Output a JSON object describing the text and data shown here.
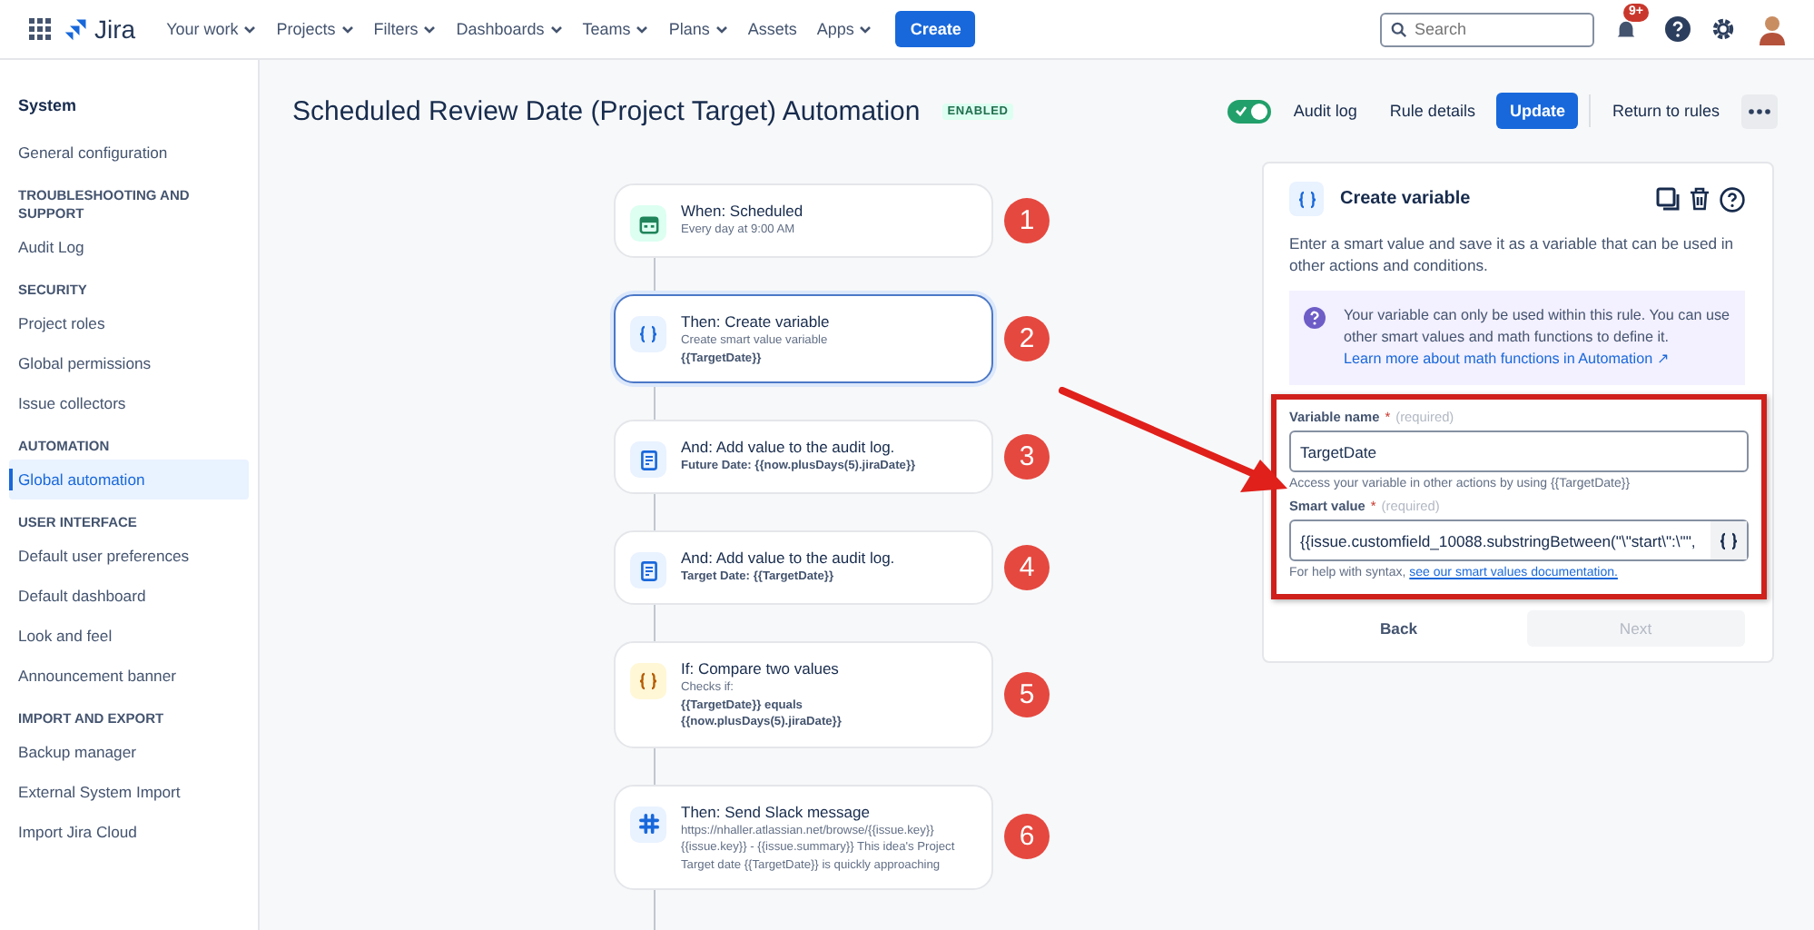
{
  "nav": {
    "product": "Jira",
    "items": [
      {
        "label": "Your work",
        "dropdown": true
      },
      {
        "label": "Projects",
        "dropdown": true
      },
      {
        "label": "Filters",
        "dropdown": true
      },
      {
        "label": "Dashboards",
        "dropdown": true
      },
      {
        "label": "Teams",
        "dropdown": true
      },
      {
        "label": "Plans",
        "dropdown": true
      },
      {
        "label": "Assets",
        "dropdown": false
      },
      {
        "label": "Apps",
        "dropdown": true
      }
    ],
    "create": "Create",
    "search": {
      "placeholder": "Search"
    },
    "notifications": "9+"
  },
  "sidebar": {
    "title": "System",
    "sections": [
      {
        "items": [
          {
            "label": "General configuration",
            "selected": false
          }
        ]
      },
      {
        "heading": "TROUBLESHOOTING AND SUPPORT",
        "items": [
          {
            "label": "Audit Log",
            "selected": false
          }
        ]
      },
      {
        "heading": "SECURITY",
        "items": [
          {
            "label": "Project roles",
            "selected": false
          },
          {
            "label": "Global permissions",
            "selected": false
          },
          {
            "label": "Issue collectors",
            "selected": false
          }
        ]
      },
      {
        "heading": "AUTOMATION",
        "items": [
          {
            "label": "Global automation",
            "selected": true
          }
        ]
      },
      {
        "heading": "USER INTERFACE",
        "items": [
          {
            "label": "Default user preferences",
            "selected": false
          },
          {
            "label": "Default dashboard",
            "selected": false
          },
          {
            "label": "Look and feel",
            "selected": false
          },
          {
            "label": "Announcement banner",
            "selected": false
          }
        ]
      },
      {
        "heading": "IMPORT AND EXPORT",
        "items": [
          {
            "label": "Backup manager",
            "selected": false
          },
          {
            "label": "External System Import",
            "selected": false
          },
          {
            "label": "Import Jira Cloud",
            "selected": false
          }
        ]
      }
    ]
  },
  "header": {
    "title": "Scheduled Review Date (Project Target) Automation",
    "status": "ENABLED",
    "toggle": {
      "on": true
    },
    "links": [
      "Audit log",
      "Rule details"
    ],
    "primary": "Update",
    "secondary": "Return to rules"
  },
  "steps": [
    {
      "kind": "calendar",
      "title": "When: Scheduled",
      "details": [
        {
          "text": "Every day at 9:00 AM",
          "bold": false
        }
      ],
      "selected": false,
      "marker": "1"
    },
    {
      "kind": "variable",
      "title": "Then: Create variable",
      "details": [
        {
          "text": "Create smart value variable",
          "bold": false
        },
        {
          "text": "{{TargetDate}}",
          "bold": true
        }
      ],
      "selected": true,
      "marker": "2"
    },
    {
      "kind": "log",
      "title": "And: Add value to the audit log.",
      "details": [
        {
          "text": "Future Date: {{now.plusDays(5).jiraDate}}",
          "bold": true
        }
      ],
      "selected": false,
      "marker": "3"
    },
    {
      "kind": "log",
      "title": "And: Add value to the audit log.",
      "details": [
        {
          "text": "Target Date: {{TargetDate}}",
          "bold": true
        }
      ],
      "selected": false,
      "marker": "4"
    },
    {
      "kind": "condition",
      "title": "If: Compare two values",
      "details": [
        {
          "text": "Checks if:",
          "bold": false
        },
        {
          "text": "{{TargetDate}} equals",
          "bold": true
        },
        {
          "text": "{{now.plusDays(5).jiraDate}}",
          "bold": true
        }
      ],
      "selected": false,
      "marker": "5"
    },
    {
      "kind": "message",
      "title": "Then: Send Slack message",
      "details": [
        {
          "text": "https://nhaller.atlassian.net/browse/{{issue.key}}",
          "bold": false
        },
        {
          "text": "{{issue.key}} - {{issue.summary}} This idea's Project Target date {{TargetDate}} is quickly approaching",
          "bold": false
        }
      ],
      "selected": false,
      "marker": "6"
    }
  ],
  "panel": {
    "title": "Create variable",
    "description": "Enter a smart value and save it as a variable that can be used in other actions and conditions.",
    "info": {
      "text": "Your variable can only be used within this rule. You can use other smart values and math functions to define it.",
      "link": "Learn more about math functions in Automation ↗"
    },
    "fields": [
      {
        "label": "Variable name",
        "asterisk": "*",
        "required": "(required)",
        "value": "TargetDate",
        "help": "Access your variable in other actions by using {{TargetDate}}",
        "smart": false
      },
      {
        "label": "Smart value",
        "asterisk": "*",
        "required": "(required)",
        "value": "{{issue.customfield_10088.substringBetween(\"\\\"start\\\":\\\"\",",
        "help": "For help with syntax,",
        "help_link": "see our smart values documentation.",
        "smart": true
      }
    ],
    "back": {
      "label": "Back",
      "disabled": false
    },
    "next": {
      "label": "Next",
      "disabled": true
    }
  }
}
